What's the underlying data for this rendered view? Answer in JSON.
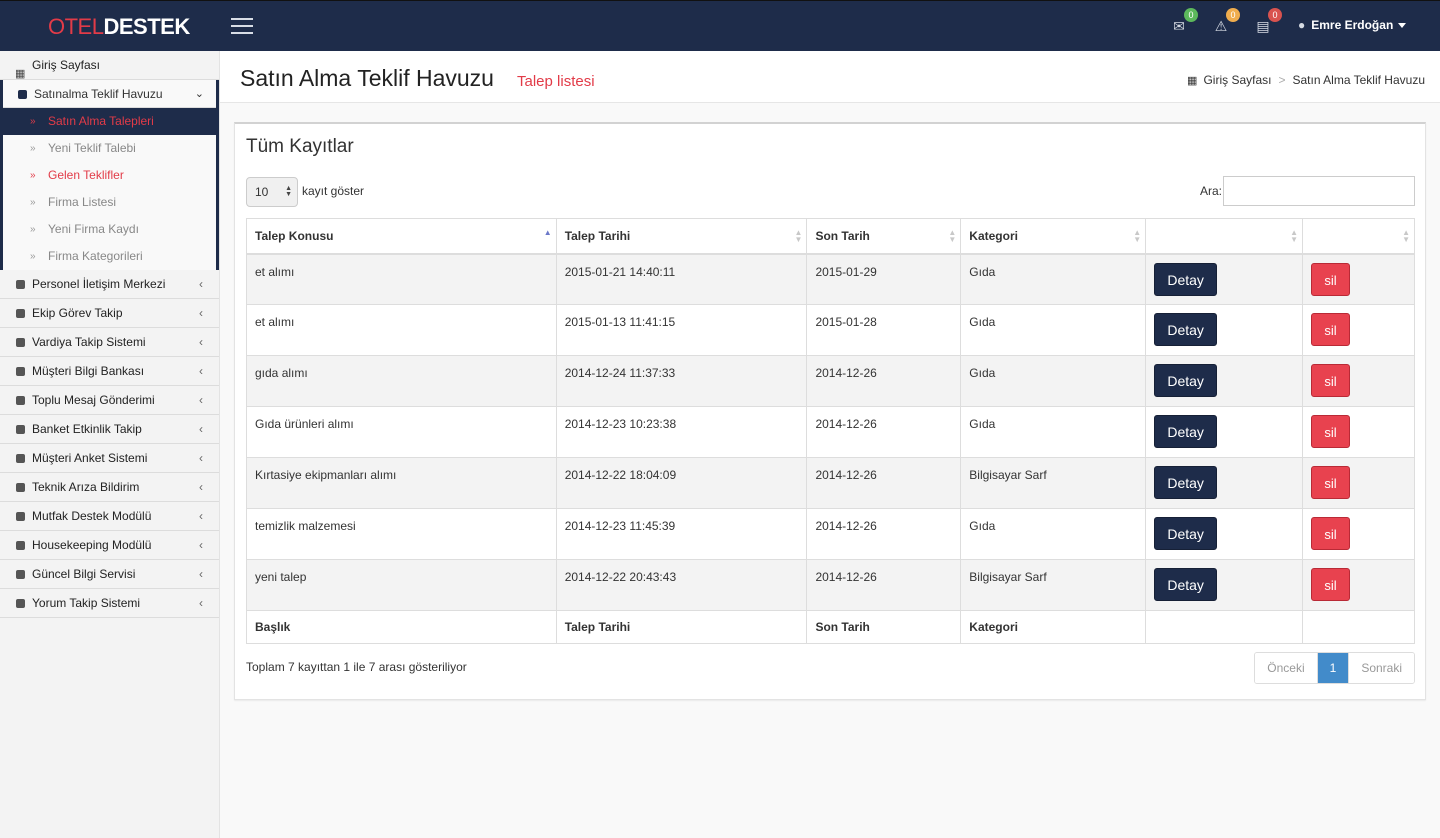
{
  "header": {
    "logo_part1": "OTEL",
    "logo_part2": "DESTEK",
    "mail_badge": "0",
    "alert_badge": "0",
    "tasks_badge": "0",
    "user_name": "Emre Erdoğan"
  },
  "colors": {
    "navy": "#1e2c4a",
    "accent_red": "#e23b48",
    "badge_green": "#5cb85c",
    "badge_orange": "#f0ad4e",
    "badge_red": "#d9534f",
    "pager_blue": "#428bca"
  },
  "sidebar": {
    "home": "Giriş Sayfası",
    "open_group": "Satınalma Teklif Havuzu",
    "sub_items": [
      "Satın Alma Talepleri",
      "Yeni Teklif Talebi",
      "Gelen Teklifler",
      "Firma Listesi",
      "Yeni Firma Kaydı",
      "Firma Kategorileri"
    ],
    "items": [
      "Personel İletişim Merkezi",
      "Ekip Görev Takip",
      "Vardiya Takip Sistemi",
      "Müşteri Bilgi Bankası",
      "Toplu Mesaj Gönderimi",
      "Banket Etkinlik Takip",
      "Müşteri Anket Sistemi",
      "Teknik Arıza Bildirim",
      "Mutfak Destek Modülü",
      "Housekeeping Modülü",
      "Güncel Bilgi Servisi",
      "Yorum Takip Sistemi"
    ]
  },
  "page": {
    "title": "Satın Alma Teklif Havuzu",
    "subtitle": "Talep listesi",
    "breadcrumb_home": "Giriş Sayfası",
    "breadcrumb_sep": ">",
    "breadcrumb_current": "Satın Alma Teklif Havuzu"
  },
  "panel": {
    "title": "Tüm Kayıtlar",
    "length_value": "10",
    "length_label": "kayıt göster",
    "search_label": "Ara:",
    "search_value": ""
  },
  "table": {
    "columns": [
      "Talep Konusu",
      "Talep Tarihi",
      "Son Tarih",
      "Kategori",
      "",
      ""
    ],
    "footer": [
      "Başlık",
      "Talep Tarihi",
      "Son Tarih",
      "Kategori",
      "",
      ""
    ],
    "detail_label": "Detay",
    "delete_label": "sil",
    "rows": [
      [
        "et alımı",
        "2015-01-21 14:40:11",
        "2015-01-29",
        "Gıda"
      ],
      [
        "et alımı",
        "2015-01-13 11:41:15",
        "2015-01-28",
        "Gıda"
      ],
      [
        "gıda alımı",
        "2014-12-24 11:37:33",
        "2014-12-26",
        "Gıda"
      ],
      [
        "Gıda ürünleri alımı",
        "2014-12-23 10:23:38",
        "2014-12-26",
        "Gıda"
      ],
      [
        "Kırtasiye ekipmanları alımı",
        "2014-12-22 18:04:09",
        "2014-12-26",
        "Bilgisayar Sarf"
      ],
      [
        "temizlik malzemesi",
        "2014-12-23 11:45:39",
        "2014-12-26",
        "Gıda"
      ],
      [
        "yeni talep",
        "2014-12-22 20:43:43",
        "2014-12-26",
        "Bilgisayar Sarf"
      ]
    ]
  },
  "footer": {
    "info": "Toplam 7 kayıttan 1 ile 7 arası gösteriliyor",
    "prev": "Önceki",
    "current_page": "1",
    "next": "Sonraki"
  }
}
